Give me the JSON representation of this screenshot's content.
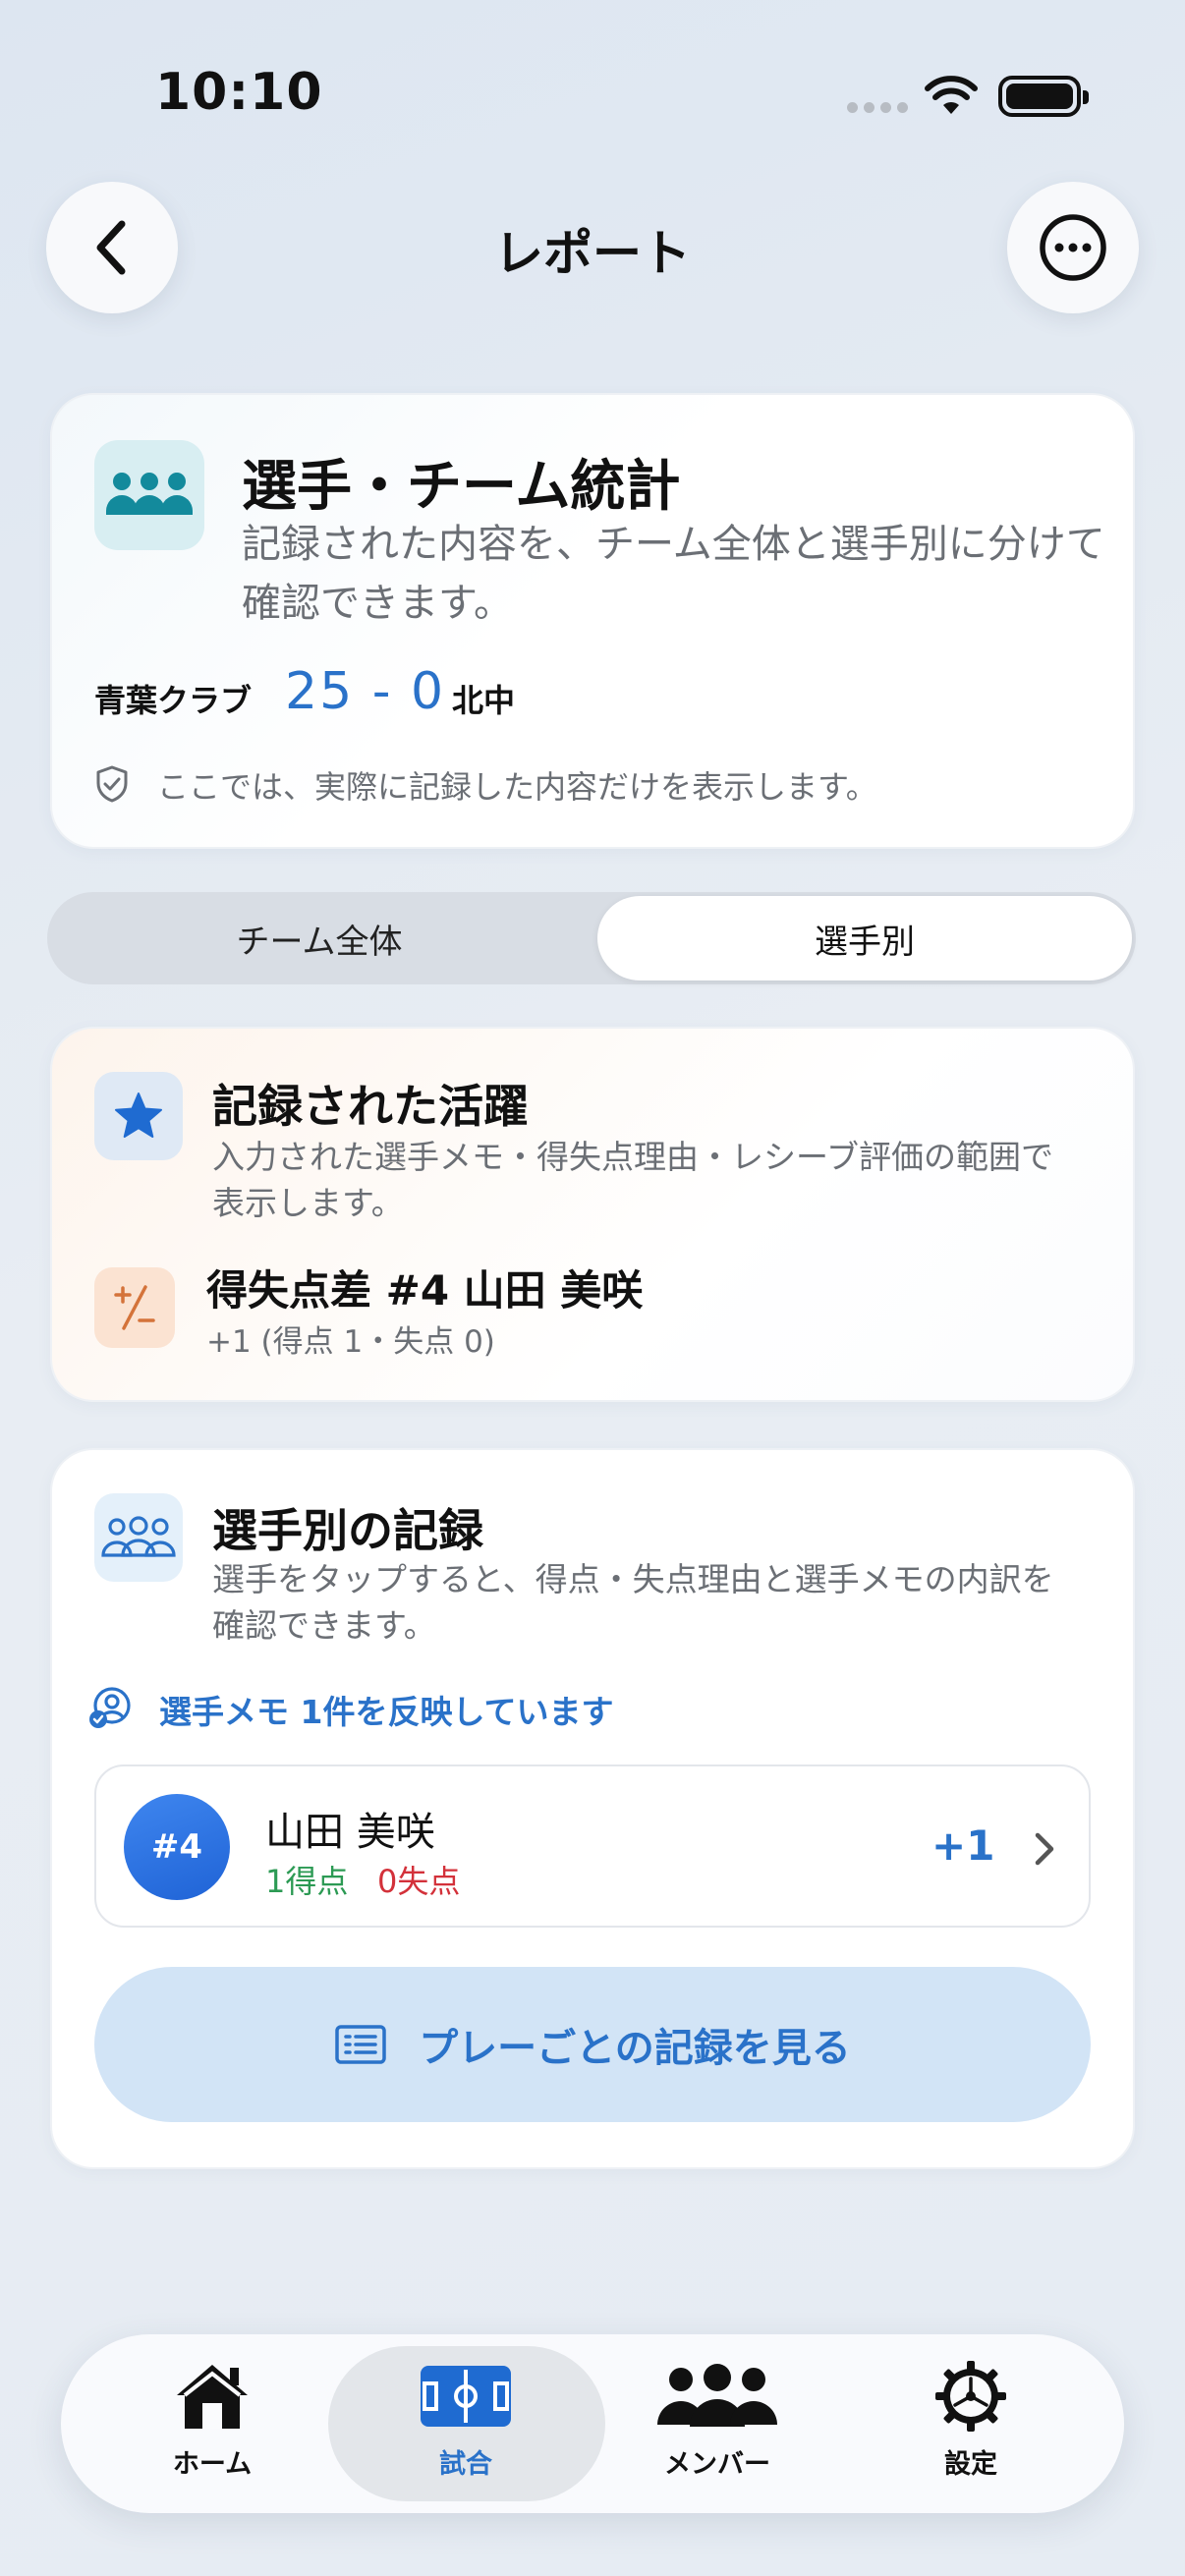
{
  "status_bar": {
    "time": "10:10"
  },
  "header": {
    "title": "レポート",
    "back_icon": "chevron-left-icon",
    "more_icon": "ellipsis-circle-icon"
  },
  "summary": {
    "title": "選手・チーム統計",
    "description": "記録された内容を、チーム全体と選手別に分けて確認できます。",
    "home_team": "青葉クラブ",
    "score": "25 - 0",
    "away_team": "北中",
    "notice": "ここでは、実際に記録した内容だけを表示します。",
    "accent": "#2a72c9"
  },
  "segmented": {
    "options": [
      "チーム全体",
      "選手別"
    ],
    "selected": "選手別"
  },
  "highlights": {
    "title": "記録された活躍",
    "description": "入力された選手メモ・得失点理由・レシーブ評価の範囲で表示します。",
    "item_title": "得失点差  #4 山田 美咲",
    "item_sub": "+1 (得点 1・失点 0)"
  },
  "player_records": {
    "title": "選手別の記録",
    "description": "選手をタップすると、得点・失点理由と選手メモの内訳を確認できます。",
    "memo_notice": "選手メモ 1件を反映しています",
    "players": [
      {
        "number": "#4",
        "name": "山田 美咲",
        "points": "1得点",
        "conceded": "0失点",
        "diff": "+1"
      }
    ],
    "plays_button": "プレーごとの記録を見る"
  },
  "tabbar": {
    "items": [
      {
        "label": "ホーム",
        "icon": "house-icon"
      },
      {
        "label": "試合",
        "icon": "court-icon"
      },
      {
        "label": "メンバー",
        "icon": "people-icon"
      },
      {
        "label": "設定",
        "icon": "gear-icon"
      }
    ],
    "selected": "試合"
  }
}
